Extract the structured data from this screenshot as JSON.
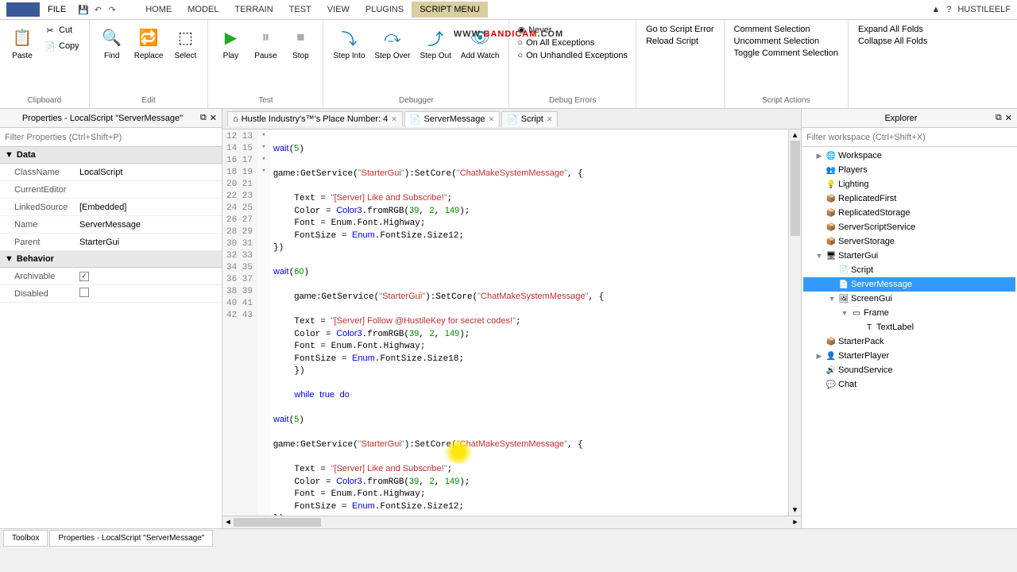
{
  "menu": {
    "file": "FILE"
  },
  "tabs": [
    "HOME",
    "MODEL",
    "TERRAIN",
    "TEST",
    "VIEW",
    "PLUGINS",
    "SCRIPT MENU"
  ],
  "user": "HUSTILEELF",
  "ribbon": {
    "clipboard": {
      "paste": "Paste",
      "cut": "Cut",
      "copy": "Copy",
      "label": "Clipboard"
    },
    "edit": {
      "find": "Find",
      "replace": "Replace",
      "select": "Select",
      "label": "Edit"
    },
    "test": {
      "play": "Play",
      "pause": "Pause",
      "stop": "Stop",
      "label": "Test"
    },
    "debugger": {
      "stepin": "Step\nInto",
      "stepover": "Step\nOver",
      "stepout": "Step\nOut",
      "addwatch": "Add\nWatch",
      "label": "Debugger"
    },
    "debugerrors": {
      "never": "Never",
      "allexc": "On All Exceptions",
      "unhandled": "On Unhandled Exceptions",
      "label": "Debug Errors"
    },
    "navigate": {
      "goto": "Go to Script Error",
      "reload": "Reload Script"
    },
    "actions": {
      "comment": "Comment Selection",
      "uncomment": "Uncomment Selection",
      "toggle": "Toggle Comment Selection",
      "expand": "Expand All Folds",
      "collapse": "Collapse All Folds",
      "label": "Script Actions"
    }
  },
  "props": {
    "title": "Properties - LocalScript \"ServerMessage\"",
    "filter_ph": "Filter Properties (Ctrl+Shift+P)",
    "data": "Data",
    "rows": [
      {
        "k": "ClassName",
        "v": "LocalScript"
      },
      {
        "k": "CurrentEditor",
        "v": ""
      },
      {
        "k": "LinkedSource",
        "v": "[Embedded]"
      },
      {
        "k": "Name",
        "v": "ServerMessage"
      },
      {
        "k": "Parent",
        "v": "StarterGui"
      }
    ],
    "behavior": "Behavior",
    "archivable": "Archivable",
    "disabled": "Disabled"
  },
  "editor_tabs": [
    {
      "icon": "⌂",
      "label": "Hustle Industry's™'s Place Number: 4",
      "close": true
    },
    {
      "icon": "📄",
      "label": "ServerMessage",
      "close": true,
      "active": true
    },
    {
      "icon": "📄",
      "label": "Script",
      "close": true
    }
  ],
  "lines_start": 12,
  "lines_end": 43,
  "explorer": {
    "title": "Explorer",
    "filter_ph": "Filter workspace (Ctrl+Shift+X)",
    "items": [
      {
        "indent": 0,
        "arrow": "▶",
        "icon": "🌐",
        "label": "Workspace"
      },
      {
        "indent": 0,
        "arrow": "",
        "icon": "👥",
        "label": "Players"
      },
      {
        "indent": 0,
        "arrow": "",
        "icon": "💡",
        "label": "Lighting"
      },
      {
        "indent": 0,
        "arrow": "",
        "icon": "📦",
        "label": "ReplicatedFirst"
      },
      {
        "indent": 0,
        "arrow": "",
        "icon": "📦",
        "label": "ReplicatedStorage"
      },
      {
        "indent": 0,
        "arrow": "",
        "icon": "📦",
        "label": "ServerScriptService"
      },
      {
        "indent": 0,
        "arrow": "",
        "icon": "📦",
        "label": "ServerStorage"
      },
      {
        "indent": 0,
        "arrow": "▼",
        "icon": "🖥",
        "label": "StarterGui"
      },
      {
        "indent": 1,
        "arrow": "",
        "icon": "📄",
        "label": "Script"
      },
      {
        "indent": 1,
        "arrow": "",
        "icon": "📄",
        "label": "ServerMessage",
        "selected": true
      },
      {
        "indent": 1,
        "arrow": "▼",
        "icon": "🖼",
        "label": "ScreenGui"
      },
      {
        "indent": 2,
        "arrow": "▼",
        "icon": "▭",
        "label": "Frame"
      },
      {
        "indent": 3,
        "arrow": "",
        "icon": "T",
        "label": "TextLabel"
      },
      {
        "indent": 0,
        "arrow": "",
        "icon": "📦",
        "label": "StarterPack"
      },
      {
        "indent": 0,
        "arrow": "▶",
        "icon": "👤",
        "label": "StarterPlayer"
      },
      {
        "indent": 0,
        "arrow": "",
        "icon": "🔊",
        "label": "SoundService"
      },
      {
        "indent": 0,
        "arrow": "",
        "icon": "💬",
        "label": "Chat"
      }
    ]
  },
  "bottom": {
    "toolbox": "Toolbox",
    "props": "Properties - LocalScript \"ServerMessage\""
  },
  "watermark": {
    "prefix": "WWW.",
    "main": "BANDICAM",
    "suffix": ".COM"
  }
}
